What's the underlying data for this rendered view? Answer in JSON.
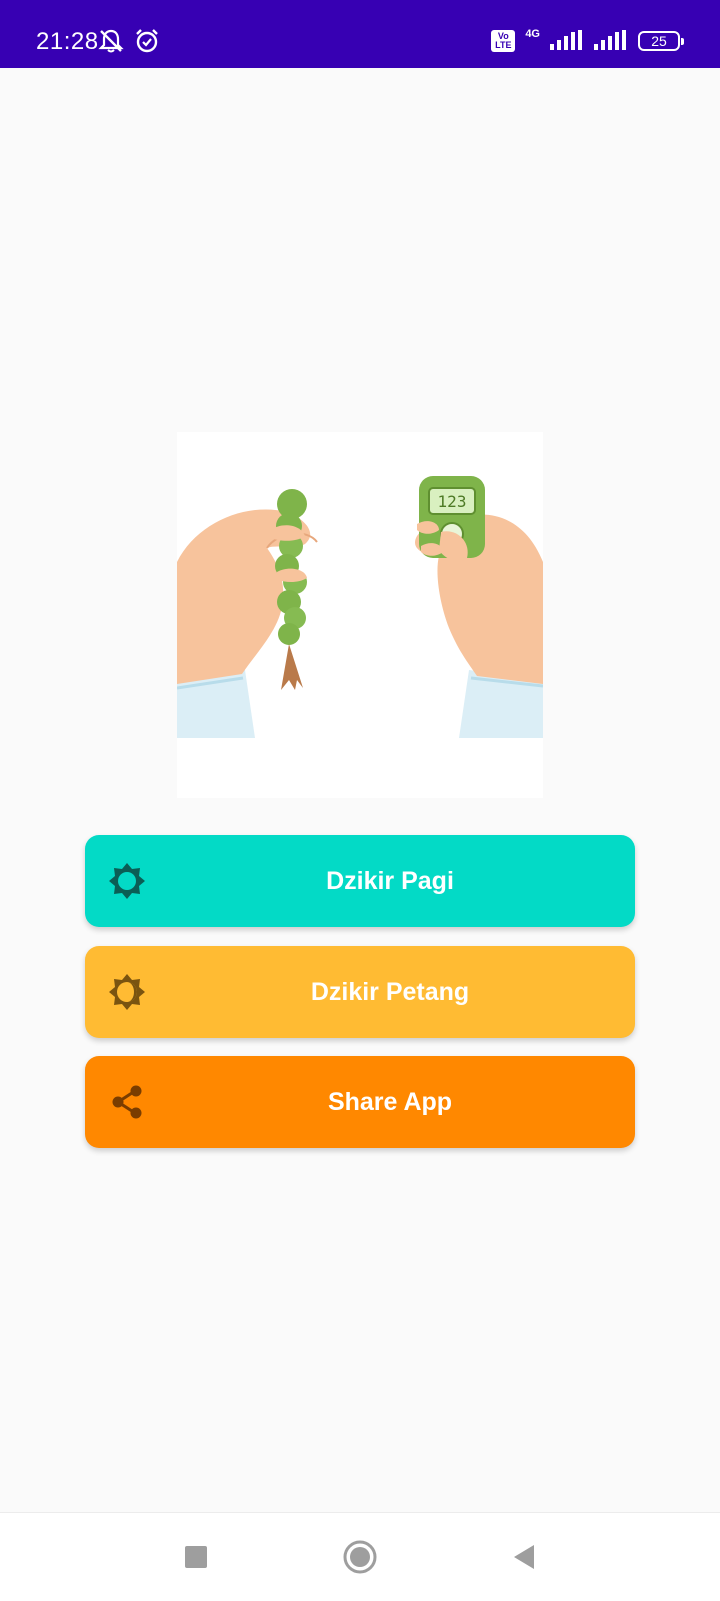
{
  "status_bar": {
    "time": "21:28",
    "network": "4G",
    "volte": "Vo LTE",
    "battery": "25",
    "icons": [
      "mute-icon",
      "alarm-icon",
      "volte-icon",
      "signal-icon",
      "signal-icon",
      "battery-icon"
    ]
  },
  "hero": {
    "counter_display": "123"
  },
  "buttons": {
    "pagi": {
      "label": "Dzikir Pagi",
      "icon": "sun-icon",
      "color": "#03dac6"
    },
    "petang": {
      "label": "Dzikir Petang",
      "icon": "sun-moon-icon",
      "color": "#ffbb33"
    },
    "share": {
      "label": "Share App",
      "icon": "share-icon",
      "color": "#ff8800"
    }
  },
  "nav_bar": {
    "items": [
      "recent-apps-icon",
      "home-icon",
      "back-icon"
    ]
  },
  "colors": {
    "status_bar": "#3700b3",
    "background": "#fafafa"
  }
}
